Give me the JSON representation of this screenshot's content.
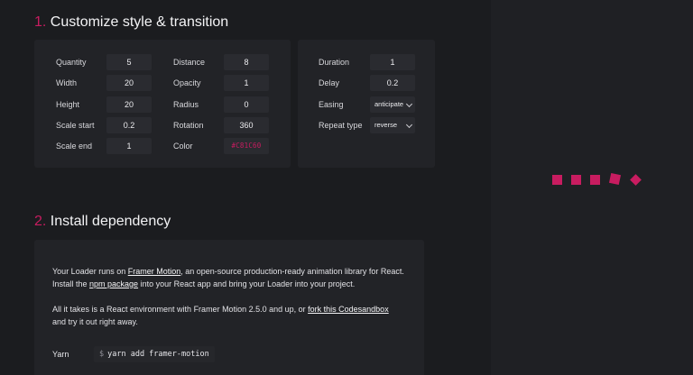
{
  "sections": {
    "customize": {
      "number": "1.",
      "title": "Customize style & transition"
    },
    "install": {
      "number": "2.",
      "title": "Install dependency"
    }
  },
  "style_panel": {
    "quantity": {
      "label": "Quantity",
      "value": "5"
    },
    "width": {
      "label": "Width",
      "value": "20"
    },
    "height": {
      "label": "Height",
      "value": "20"
    },
    "scale_start": {
      "label": "Scale start",
      "value": "0.2"
    },
    "scale_end": {
      "label": "Scale end",
      "value": "1"
    },
    "distance": {
      "label": "Distance",
      "value": "8"
    },
    "opacity": {
      "label": "Opacity",
      "value": "1"
    },
    "radius": {
      "label": "Radius",
      "value": "0"
    },
    "rotation": {
      "label": "Rotation",
      "value": "360"
    },
    "color": {
      "label": "Color",
      "value": "#C81C60"
    }
  },
  "transition_panel": {
    "duration": {
      "label": "Duration",
      "value": "1"
    },
    "delay": {
      "label": "Delay",
      "value": "0.2"
    },
    "easing": {
      "label": "Easing",
      "value": "anticipate"
    },
    "repeat_type": {
      "label": "Repeat type",
      "value": "reverse"
    }
  },
  "install": {
    "p1_before": "Your Loader runs on ",
    "p1_link": "Framer Motion",
    "p1_mid": ", an open-source production-ready animation library for React. Install the ",
    "p1_link2": "npm package",
    "p1_after": " into your React app and bring your Loader into your project.",
    "p2_before": "All it takes is a React environment with Framer Motion 2.5.0 and up, or ",
    "p2_link": "fork this Codesandbox",
    "p2_after": " and try it out right away.",
    "yarn_label": "Yarn",
    "prompt": "$",
    "command": "yarn add framer-motion"
  },
  "colors": {
    "accent": "#C81C60"
  },
  "loader_icons": [
    "square",
    "square",
    "square",
    "rotated-square",
    "diamond"
  ]
}
